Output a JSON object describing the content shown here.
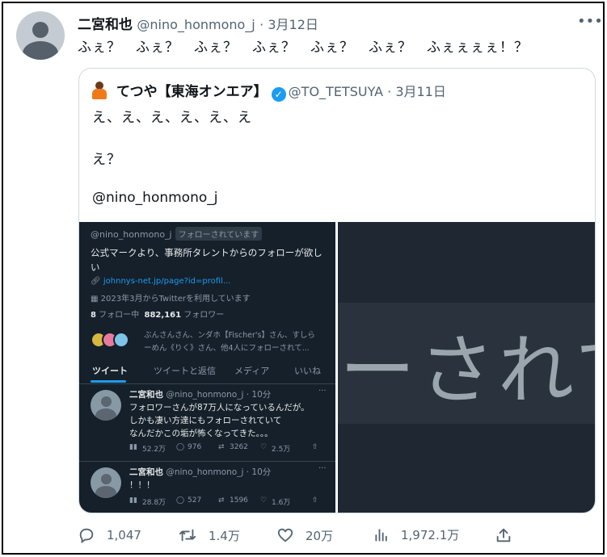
{
  "tweet": {
    "author_name": "二宮和也",
    "handle": "@nino_honmono_j",
    "date": "3月12日",
    "text": "ふぇ？　ふぇ？　ふぇ？　ふぇ？　ふぇ？　ふぇ？　ふぇぇぇぇ！？"
  },
  "quote": {
    "author_name": "てつや【東海オンエア】",
    "handle": "@TO_TETSUYA",
    "date": "3月11日",
    "line1": "え、え、え、え、え、え",
    "line2": "え？",
    "line3": "@nino_honmono_j"
  },
  "screenshot": {
    "handle": "@nino_honmono_j",
    "follows_you_badge": "フォローされています",
    "bio_line1": "公式マークより、事務所タレントからのフォローが欲し",
    "bio_line2": "い",
    "link": "johnnys-net.jp/page?id=profil...",
    "joined": "2023年3月からTwitterを利用しています",
    "following_count": "8",
    "following_label": "フォロー中",
    "followers_count": "882,161",
    "followers_label": "フォロワー",
    "followed_by_line1": "ぶんさんさん、ンダホ【Fischer's】さん、すしら",
    "followed_by_line2": "ーめん《りく》さん、他4人にフォローされて...",
    "tabs": [
      "ツイート",
      "ツイートと返信",
      "メディア",
      "いいね"
    ],
    "posts": [
      {
        "name": "二宮和也",
        "meta": "@nino_honmono_j · 10分",
        "lines": [
          "フォロワーさんが87万人になっているんだが。",
          "しかも凄い方達にもフォローされていて",
          "なんだかこの垢が怖くなってきた。。。"
        ],
        "views": "52.2万",
        "replies": "976",
        "retweets": "3262",
        "likes": "2.5万"
      },
      {
        "name": "二宮和也",
        "meta": "@nino_honmono_j · 10分",
        "lines": [
          "！！！"
        ],
        "views": "28.8万",
        "replies": "527",
        "retweets": "1596",
        "likes": "1.6万"
      }
    ],
    "zoom_text": "ーされて"
  },
  "actions": {
    "replies": "1,047",
    "retweets": "1.4万",
    "likes": "20万",
    "views": "1,972.1万"
  },
  "colors": {
    "accent": "#1d9bf0",
    "dark_bg": "#15202b"
  }
}
